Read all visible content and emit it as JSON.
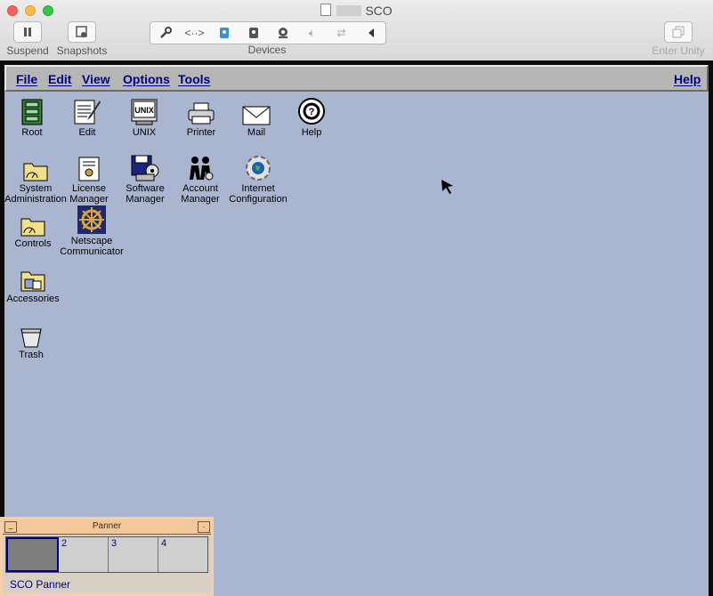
{
  "window": {
    "title": "SCO"
  },
  "toolbar": {
    "suspend_label": "Suspend",
    "snapshots_label": "Snapshots",
    "devices_label": "Devices",
    "enter_unity_label": "Enter Unity",
    "device_icons": [
      "wrench-icon",
      "network-icon",
      "hard-disk-icon",
      "floppy-icon",
      "camera-icon",
      "sound-icon",
      "usb-icon",
      "collapse-arrow-icon"
    ]
  },
  "menubar": {
    "file": "File",
    "edit": "Edit",
    "view": "View",
    "options": "Options",
    "tools": "Tools",
    "help": "Help"
  },
  "icons": [
    {
      "id": "root",
      "label": "Root",
      "icon": "root-icon"
    },
    {
      "id": "edit",
      "label": "Edit",
      "icon": "edit-icon"
    },
    {
      "id": "unix",
      "label": "UNIX",
      "icon": "unix-icon"
    },
    {
      "id": "printer",
      "label": "Printer",
      "icon": "printer-icon"
    },
    {
      "id": "mail",
      "label": "Mail",
      "icon": "mail-icon"
    },
    {
      "id": "help",
      "label": "Help",
      "icon": "help-icon"
    },
    {
      "id": "sysadmin",
      "label1": "System",
      "label2": "Administration",
      "icon": "folder-icon"
    },
    {
      "id": "license",
      "label1": "License",
      "label2": "Manager",
      "icon": "certificate-icon"
    },
    {
      "id": "software",
      "label1": "Software",
      "label2": "Manager",
      "icon": "software-icon"
    },
    {
      "id": "account",
      "label1": "Account",
      "label2": "Manager",
      "icon": "users-icon"
    },
    {
      "id": "internet",
      "label1": "Internet",
      "label2": "Configuration",
      "icon": "globe-icon"
    },
    {
      "id": "controls",
      "label": "Controls",
      "icon": "folder-icon"
    },
    {
      "id": "netscape",
      "label1": "Netscape",
      "label2": "Communicator",
      "icon": "ship-wheel-icon"
    },
    {
      "id": "accessories",
      "label": "Accessories",
      "icon": "folder-icon"
    },
    {
      "id": "trash",
      "label": "Trash",
      "icon": "trash-icon"
    }
  ],
  "panner": {
    "title": "Panner",
    "label": "SCO Panner",
    "panes": [
      "",
      "2",
      "3",
      "4"
    ],
    "active_pane": 1
  },
  "colors": {
    "desktop": "#aab5cf",
    "menu_text": "#00008b",
    "panner_titlebar": "#f4c79a"
  }
}
